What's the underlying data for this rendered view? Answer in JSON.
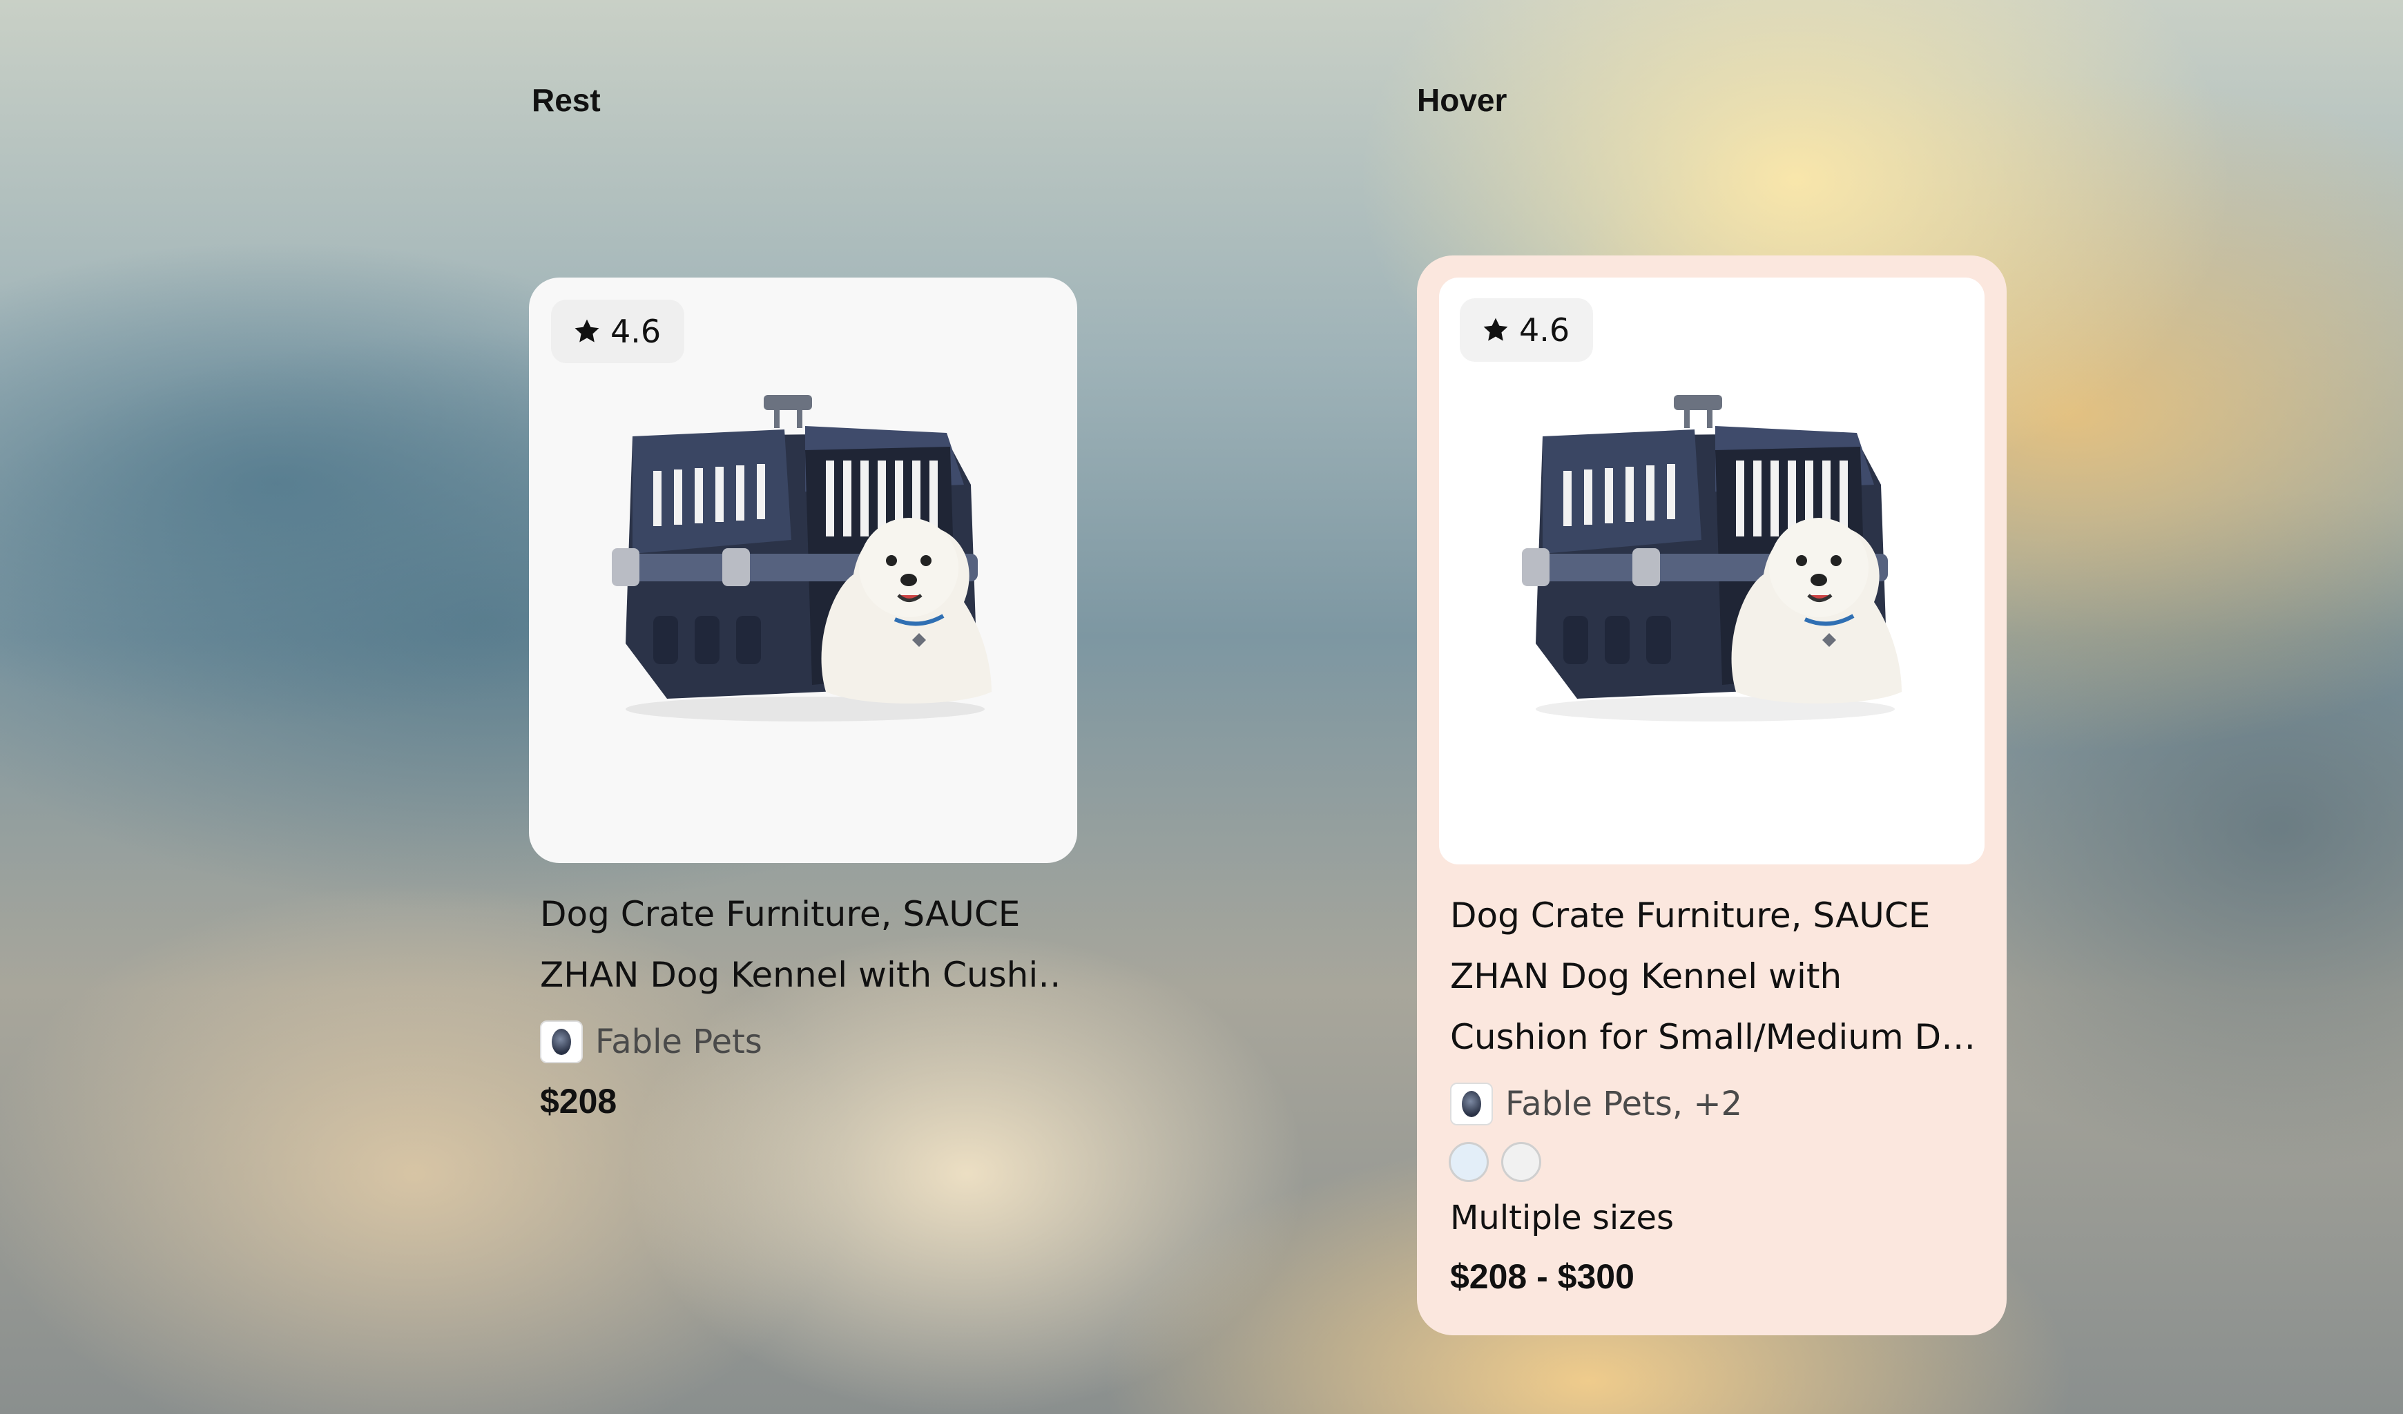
{
  "labels": {
    "rest": "Rest",
    "hover": "Hover"
  },
  "rest_card": {
    "rating": "4.6",
    "rating_icon": "star-icon",
    "title_lines": [
      "Dog Crate Furniture, SAUCE",
      "ZHAN Dog Kennel with Cushi…"
    ],
    "merchant": "Fable Pets",
    "price": "$208"
  },
  "hover_card": {
    "rating": "4.6",
    "rating_icon": "star-icon",
    "title_lines": [
      "Dog Crate Furniture, SAUCE",
      "ZHAN Dog Kennel with",
      "Cushion for Small/Medium D…"
    ],
    "merchant": "Fable Pets, +2",
    "swatches": [
      {
        "name": "light-blue",
        "color": "#e3eef8"
      },
      {
        "name": "light-gray",
        "color": "#f1f1f1"
      }
    ],
    "options": "Multiple sizes",
    "price": "$208 - $300",
    "background": "#fbe7de"
  }
}
